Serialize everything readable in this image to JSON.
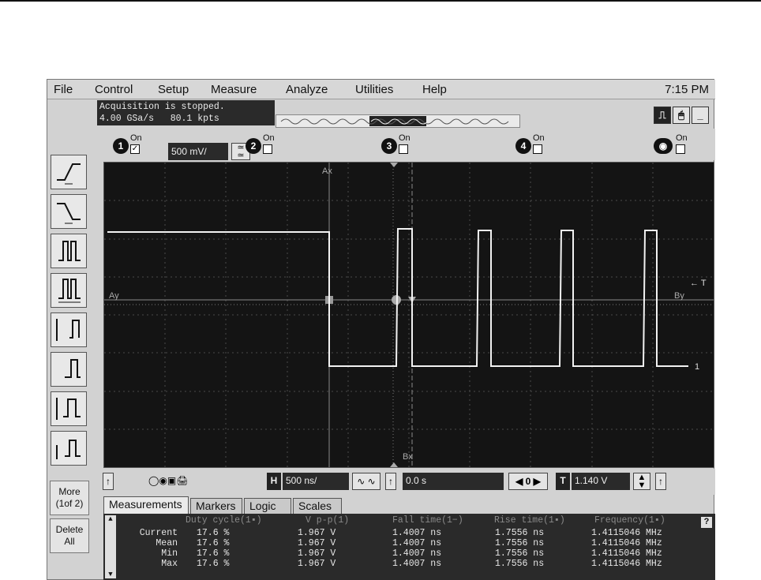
{
  "menu": {
    "items": [
      "File",
      "Control",
      "Setup",
      "Measure",
      "Analyze",
      "Utilities",
      "Help"
    ],
    "clock": "7:15 PM"
  },
  "status": {
    "line1": "Acquisition is stopped.",
    "line2": "4.00 GSa/s   80.1 kpts"
  },
  "channels": {
    "ch1": {
      "num": "1",
      "on": "On",
      "checked": "✓",
      "scale": "500 mV/"
    },
    "ch2": {
      "num": "2",
      "on": "On"
    },
    "ch3": {
      "num": "3",
      "on": "On"
    },
    "ch4": {
      "num": "4",
      "on": "On"
    },
    "math": {
      "on": "On"
    }
  },
  "screen": {
    "marker_ax": "Ax",
    "marker_ay": "Ay",
    "marker_bx": "Bx",
    "marker_by": "By",
    "trigger_label": "← T",
    "ground_label": "1"
  },
  "left_panel": {
    "more_line1": "More",
    "more_line2": "(1of 2)",
    "delete_line1": "Delete",
    "delete_line2": "All"
  },
  "horizontal": {
    "scale": "500 ns/",
    "delay": "0.0 s",
    "trigger_level": "1.140 V",
    "h_icon": "H",
    "t_icon": "T",
    "center": "0"
  },
  "tabs": [
    "Measurements",
    "Markers",
    "Logic",
    "Scales"
  ],
  "measurements": {
    "headers": [
      "Duty cycle(1▪)",
      "V p-p(1)",
      "Fall time(1−)",
      "Rise time(1▪)",
      "Frequency(1▪)"
    ],
    "rows": [
      {
        "label": "Current",
        "values": [
          "17.6 %",
          "1.967 V",
          "1.4007 ns",
          "1.7556 ns",
          "1.4115046 MHz"
        ]
      },
      {
        "label": "Mean",
        "values": [
          "17.6 %",
          "1.967 V",
          "1.4007 ns",
          "1.7556 ns",
          "1.4115046 MHz"
        ]
      },
      {
        "label": "Min",
        "values": [
          "17.6 %",
          "1.967 V",
          "1.4007 ns",
          "1.7556 ns",
          "1.4115046 MHz"
        ]
      },
      {
        "label": "Max",
        "values": [
          "17.6 %",
          "1.967 V",
          "1.4007 ns",
          "1.7556 ns",
          "1.4115046 MHz"
        ]
      }
    ],
    "help": "?"
  },
  "colors": {
    "screen_bg": "#141414",
    "trace": "#f2f2f2",
    "grid": "#5a5a5a",
    "panel": "#2a2a2a"
  }
}
